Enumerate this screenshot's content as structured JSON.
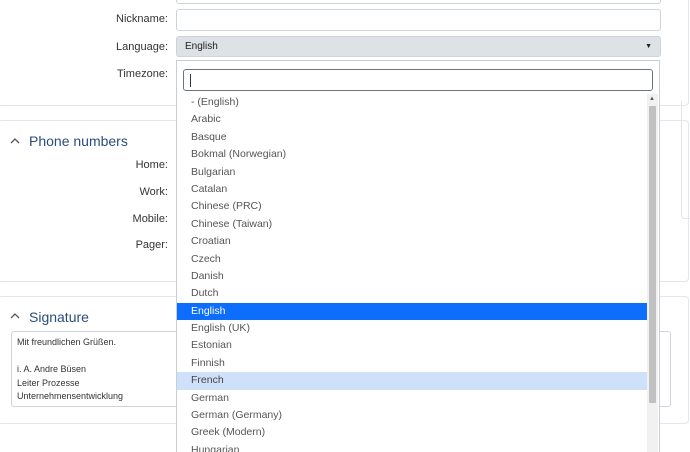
{
  "personal": {
    "nickname_label": "Nickname:",
    "nickname_value": "",
    "language_label": "Language:",
    "language_value": "English",
    "timezone_label": "Timezone:"
  },
  "phone": {
    "title": "Phone numbers",
    "home_label": "Home:",
    "work_label": "Work:",
    "mobile_label": "Mobile:",
    "pager_label": "Pager:"
  },
  "signature": {
    "title": "Signature",
    "lines": [
      "Mit freundlichen Grüßen.",
      "",
      "i. A. Andre Büsen",
      "Leiter Prozesse",
      "Unternehmensentwicklung"
    ]
  },
  "dropdown": {
    "search_value": "",
    "options": [
      "- (English)",
      "Arabic",
      "Basque",
      "Bokmal (Norwegian)",
      "Bulgarian",
      "Catalan",
      "Chinese (PRC)",
      "Chinese (Taiwan)",
      "Croatian",
      "Czech",
      "Danish",
      "Dutch",
      "English",
      "English (UK)",
      "Estonian",
      "Finnish",
      "French",
      "German",
      "German (Germany)",
      "Greek (Modern)",
      "Hungarian"
    ],
    "selected": "English",
    "hovered": "French"
  },
  "colors": {
    "accent": "#0d6efd",
    "hover": "#cfe0fa",
    "section_title": "#2c4d7a"
  }
}
